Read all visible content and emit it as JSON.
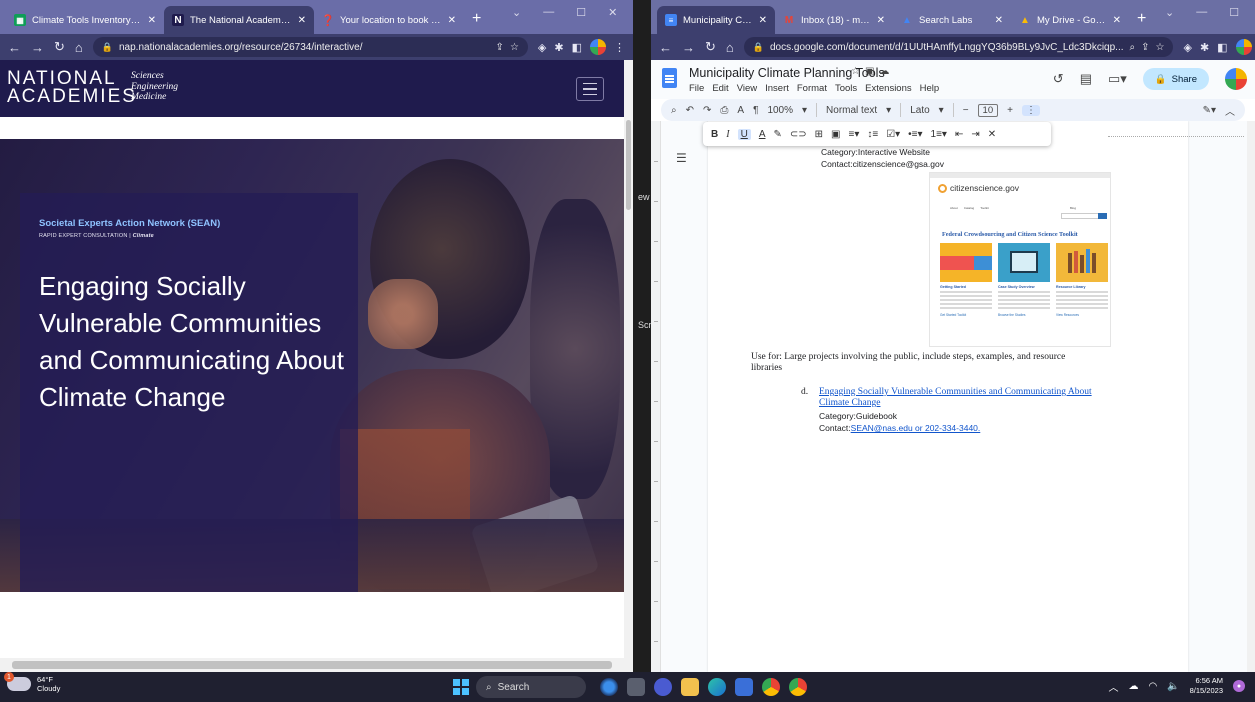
{
  "left_browser": {
    "tabs": [
      {
        "title": "Climate Tools Inventory - Goog",
        "icon": "sheets-icon",
        "color": "#0f9d58"
      },
      {
        "title": "The National Academies of Scie",
        "icon": "nas-icon",
        "color": "#1f1b4d",
        "active": true
      },
      {
        "title": "Your location to book deposit",
        "icon": "help-icon",
        "color": "#f0a800"
      }
    ],
    "url": "nap.nationalacademies.org/resource/26734/interactive/",
    "page": {
      "logo_line1": "NATIONAL",
      "logo_line2": "ACADEMIES",
      "logo_sub": [
        "Sciences",
        "Engineering",
        "Medicine"
      ],
      "eyebrow": "Societal Experts Action Network (SEAN)",
      "crumb_prefix": "RAPID EXPERT CONSULTATION | ",
      "crumb_bold": "Climate",
      "title": "Engaging Socially Vulnerable Communities and Communicating About Climate Change"
    }
  },
  "gap_texts": [
    "ew",
    "Scr"
  ],
  "right_browser": {
    "tabs": [
      {
        "title": "Municipality Climat",
        "icon": "docs-icon",
        "color": "#4285f4",
        "active": true
      },
      {
        "title": "Inbox (18) - manasi",
        "icon": "gmail-icon",
        "color": "#ea4335"
      },
      {
        "title": "Search Labs",
        "icon": "labs-icon",
        "color": "#4285f4"
      },
      {
        "title": "My Drive - Google",
        "icon": "drive-icon",
        "color": "#fbbc04"
      }
    ],
    "url": "docs.google.com/document/d/1UUtHAmffyLnggYQ36b9BLy9JvC_Ldc3Dkciqp...",
    "doc": {
      "title": "Municipality Climate Planning Tools",
      "menu": [
        "File",
        "Edit",
        "View",
        "Insert",
        "Format",
        "Tools",
        "Extensions",
        "Help"
      ],
      "share_label": "Share",
      "zoom": "100%",
      "style": "Normal text",
      "font": "Lato",
      "font_size": "10",
      "category_1": "Category:Interactive Website",
      "contact_1": "Contact:citizenscience@gsa.gov",
      "use_for": "Use for: Large projects involving the public, include steps, examples, and resource libraries",
      "item_marker": "d.",
      "item_link": "Engaging Socially Vulnerable Communities and Communicating About Climate Change",
      "category_2": "Category:Guidebook",
      "contact_2_prefix": "Contact:",
      "contact_2": "SEAN@nas.edu or 202-334-3440."
    },
    "screenshot": {
      "logo": "citizenscience.gov",
      "nav": [
        "About",
        "Catalog",
        "Toolkit"
      ],
      "blog": "Blog",
      "heading": "Federal Crowdsourcing and Citizen Science Toolkit",
      "columns": [
        {
          "title": "Getting Started",
          "more": "Get Started Toolkit"
        },
        {
          "title": "Case Study Overview",
          "more": "Browse the Studies"
        },
        {
          "title": "Resource Library",
          "more": "View Resources"
        }
      ]
    }
  },
  "taskbar": {
    "temp": "64°F",
    "condition": "Cloudy",
    "weather_badge": "1",
    "search_label": "Search",
    "time": "6:56 AM",
    "date": "8/15/2023"
  }
}
